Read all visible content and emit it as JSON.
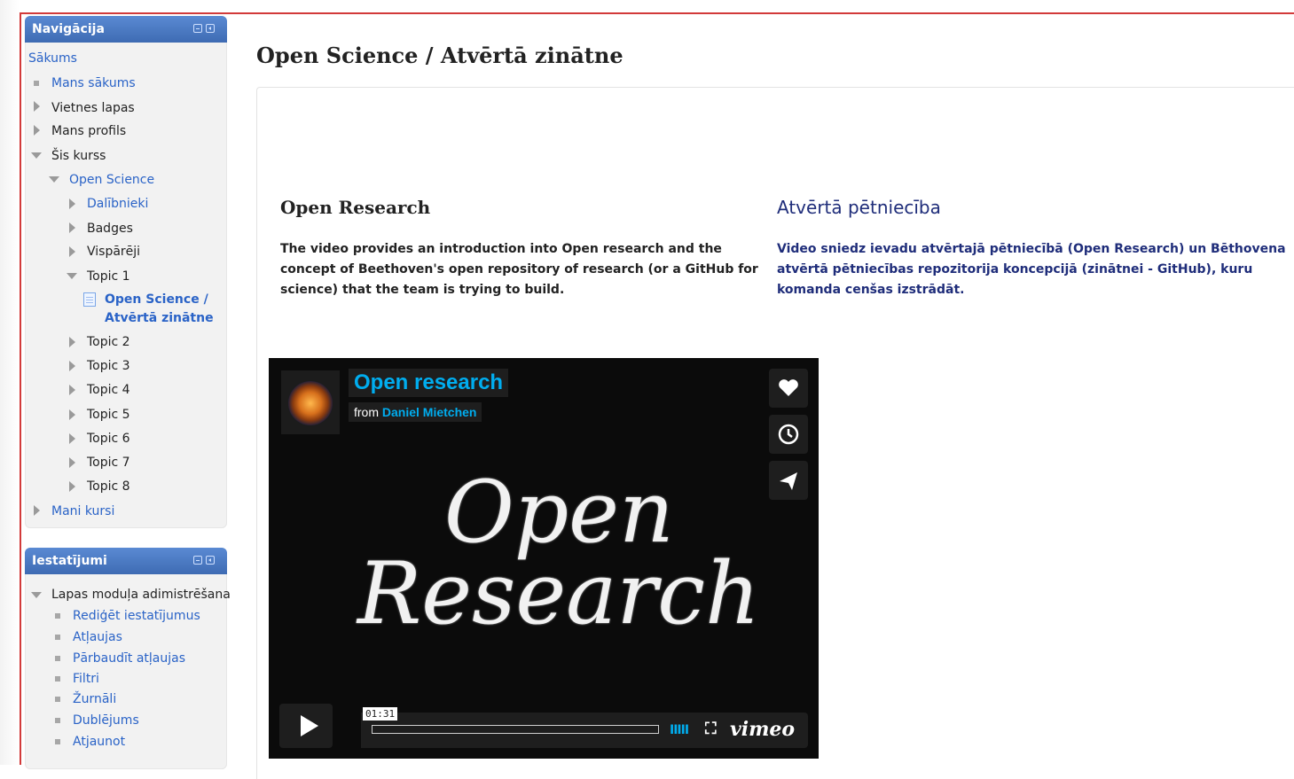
{
  "navigation": {
    "title": "Navigācija",
    "items": {
      "home": "Sākums",
      "my_home": "Mans sākums",
      "site_pages": "Vietnes lapas",
      "my_profile": "Mans profils",
      "this_course": "Šis kurss",
      "open_science": "Open Science",
      "participants": "Dalībnieki",
      "badges": "Badges",
      "general": "Vispārēji",
      "topic1": "Topic 1",
      "current_page_line1": "Open Science /",
      "current_page_line2": "Atvērtā zinātne",
      "topic2": "Topic 2",
      "topic3": "Topic 3",
      "topic4": "Topic 4",
      "topic5": "Topic 5",
      "topic6": "Topic 6",
      "topic7": "Topic 7",
      "topic8": "Topic 8",
      "my_courses": "Mani kursi"
    }
  },
  "settings": {
    "title": "Iestatījumi",
    "module_admin": "Lapas moduļa adimistrēšana",
    "items": [
      "Rediģēt iestatījumus",
      "Atļaujas",
      "Pārbaudīt atļaujas",
      "Filtri",
      "Žurnāli",
      "Dublējums",
      "Atjaunot"
    ]
  },
  "page": {
    "title": "Open Science / Atvērtā zinātne",
    "en": {
      "heading": "Open Research",
      "text": "The video provides an introduction into Open research and the concept of Beethoven's open repository of research (or a GitHub for science) that the team is trying to build."
    },
    "lv": {
      "heading": "Atvērtā pētniecība",
      "text": "Video sniedz ievadu atvērtajā pētniecībā (Open Research) un Bēthovena atvērtā pētniecības repozitorija koncepcijā (zinātnei - GitHub), kuru komanda cenšas izstrādāt."
    }
  },
  "video": {
    "title": "Open research",
    "from_label": "from",
    "author": "Daniel Mietchen",
    "chalk_line1": "Open",
    "chalk_line2": "Research",
    "time": "01:31",
    "brand": "vimeo",
    "volume_glyph": "IIIII",
    "fullscreen_glyph": "⛶",
    "accent": "#00adef"
  },
  "colors": {
    "block_header": "#4a78c2",
    "link": "#2a63c7",
    "frame_border": "#d23a3a",
    "lv_text": "#1f2d7a"
  }
}
